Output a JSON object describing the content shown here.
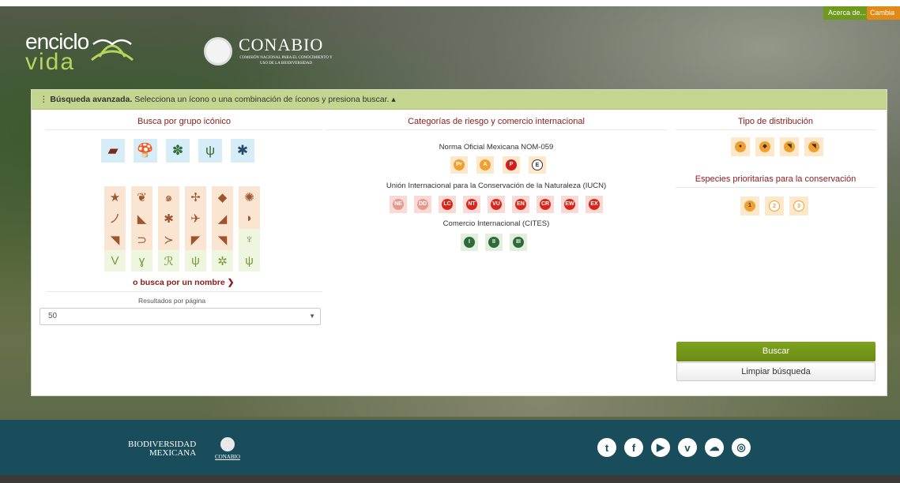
{
  "header": {
    "logo_line1": "enciclo",
    "logo_line2": "vida",
    "conabio_name": "CONABIO",
    "conabio_sub": "COMISIÓN NACIONAL PARA EL CONOCIMIENTO Y USO DE LA BIODIVERSIDAD",
    "acerca_label": "Acerca de... ▾",
    "cambia_label": "Cambia"
  },
  "search": {
    "header_bold": "Búsqueda avanzada.",
    "header_text": " Selecciona un ícono o una combinación de íconos y presiona buscar. ▴",
    "col1_title": "Busca por grupo icónico",
    "col2_title": "Categorías de riesgo y comercio internacional",
    "col3_title": "Tipo de distribución",
    "nom_title": "Norma Oficial Mexicana NOM-059",
    "iucn_title": "Unión Internacional para la Conservación de la Naturaleza (IUCN)",
    "cites_title": "Comercio Internacional (CITES)",
    "prio_title": "Especies prioritarias para la conservación",
    "nombre_link": "o busca por un nombre ❯",
    "results_label": "Resultados por página",
    "results_value": "50",
    "buscar_label": "Buscar",
    "limpiar_label": "Limpiar búsqueda"
  },
  "icons": {
    "big_groups": [
      "mammal-icon",
      "fungi-icon",
      "plant-icon",
      "algae-icon",
      "spider-icon"
    ],
    "grid": [
      [
        "★",
        "❦",
        "๑",
        "✢",
        "◆",
        "✺"
      ],
      [
        "ノ",
        "◣",
        "✱",
        "✈",
        "◢",
        "◗"
      ],
      [
        "◥",
        "⊃",
        "≻",
        "◤",
        "◥",
        "♆"
      ],
      [
        "V",
        "ɣ",
        "ℛ",
        "ψ",
        "✲",
        "ψ"
      ]
    ]
  },
  "nom": [
    "Pr",
    "A",
    "P",
    "E"
  ],
  "iucn": [
    "NE",
    "DD",
    "LC",
    "NT",
    "VU",
    "EN",
    "CR",
    "EW",
    "EX"
  ],
  "cites": [
    "I",
    "II",
    "III"
  ],
  "prio": [
    "1",
    "2",
    "3"
  ],
  "colors": {
    "accent_green": "#6e9b1e",
    "accent_orange": "#e28a16",
    "title_red": "#8c1b1b",
    "footer": "#1a4d5c",
    "panel_header": "#c3d58f"
  },
  "footer": {
    "bio_line1": "BIODIVERSIDAD",
    "bio_line2": "MEXICANA",
    "conabio_small": "CONABIO",
    "social": [
      "twitter-icon",
      "facebook-icon",
      "youtube-icon",
      "vimeo-icon",
      "soundcloud-icon",
      "instagram-icon"
    ]
  }
}
